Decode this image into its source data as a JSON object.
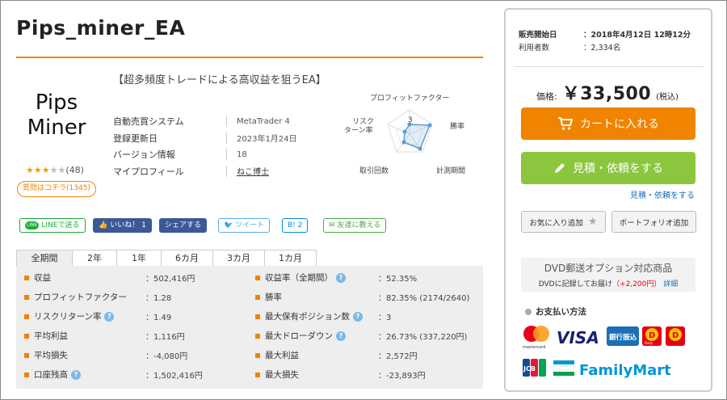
{
  "product": {
    "title": "Pips_miner_EA",
    "logo_line1": "Pips",
    "logo_line2": "Miner",
    "rating_count": "(48)",
    "rating_stars": 3,
    "question_button": "質問はコチラ(1345)",
    "catchphrase": "【超多頻度トレードによる高収益を狙うEA】"
  },
  "spec": [
    {
      "label": "自動売買システム",
      "value": "MetaTrader 4"
    },
    {
      "label": "登録更新日",
      "value": "2023年1月24日"
    },
    {
      "label": "バージョン情報",
      "value": "18"
    },
    {
      "label": "マイプロフィール",
      "value": "ねこ博士"
    }
  ],
  "radar": {
    "labels": [
      "プロフィットファクター",
      "勝率",
      "計測期間",
      "取引回数",
      "リスクターン率"
    ],
    "label_risk_line1": "リスク",
    "label_risk_line2": "ターン率",
    "scale_label": "3",
    "values": [
      2,
      4,
      4,
      2,
      1
    ]
  },
  "share": {
    "line": "LINEで送る",
    "line_icon": "LINE",
    "like": "いいね！ 1",
    "fb_share": "シェアする",
    "tweet": "ツイート",
    "hatena": "B! 2",
    "friend": "友達に教える"
  },
  "tabs": [
    "全期間",
    "2年",
    "1年",
    "6カ月",
    "3カ月",
    "1カ月"
  ],
  "stats_left": [
    {
      "label": "収益",
      "value": "：502,416円",
      "help": false
    },
    {
      "label": "プロフィットファクター",
      "value": "：1.28",
      "help": false
    },
    {
      "label": "リスクリターン率",
      "value": "：1.49",
      "help": true
    },
    {
      "label": "平均利益",
      "value": "：1,116円",
      "help": false
    },
    {
      "label": "平均損失",
      "value": "：-4,080円",
      "help": false
    },
    {
      "label": "口座残高",
      "value": "：1,502,416円",
      "help": true
    }
  ],
  "stats_right": [
    {
      "label": "収益率（全期間）",
      "value": "：52.35%",
      "help": true
    },
    {
      "label": "勝率",
      "value": "：82.35% (2174/2640)",
      "help": false
    },
    {
      "label": "最大保有ポジション数",
      "value": "：3",
      "help": true
    },
    {
      "label": "最大ドローダウン",
      "value": "：26.73% (337,220円)",
      "help": true
    },
    {
      "label": "最大利益",
      "value": "：2,572円",
      "help": false
    },
    {
      "label": "最大損失",
      "value": "：-23,893円",
      "help": false
    }
  ],
  "panel": {
    "sale_start_label": "販売開始日",
    "sale_start_value": "：2018年4月12日 12時12分",
    "users_label": "利用者数",
    "users_value": "：2,334名",
    "price_label": "価格:",
    "price_value": "￥33,500",
    "tax_label": "(税込)",
    "cart_button": "カートに入れる",
    "quote_button": "見積・依頼をする",
    "quote_link": "見積・依頼をする",
    "favorite_button": "お気に入り追加",
    "portfolio_button": "ポートフォリオ追加",
    "dvd_title": "DVD郵送オプション対応商品",
    "dvd_text": "DVDに記録してお届け",
    "dvd_price": "（+2,200円）",
    "dvd_link": "詳細",
    "payment_title": "お支払い方法",
    "pay_visa": "VISA",
    "pay_bank": "銀行振込",
    "pay_familymart": "FamilyMart",
    "pay_mastercard": "mastercard",
    "pay_jcb": "JCB",
    "pay_daily": "Daily"
  },
  "colors": {
    "accent_orange": "#f08300",
    "green": "#8cc63f",
    "link_blue": "#1a6fb5",
    "radar_blue": "#5a9bd4"
  }
}
